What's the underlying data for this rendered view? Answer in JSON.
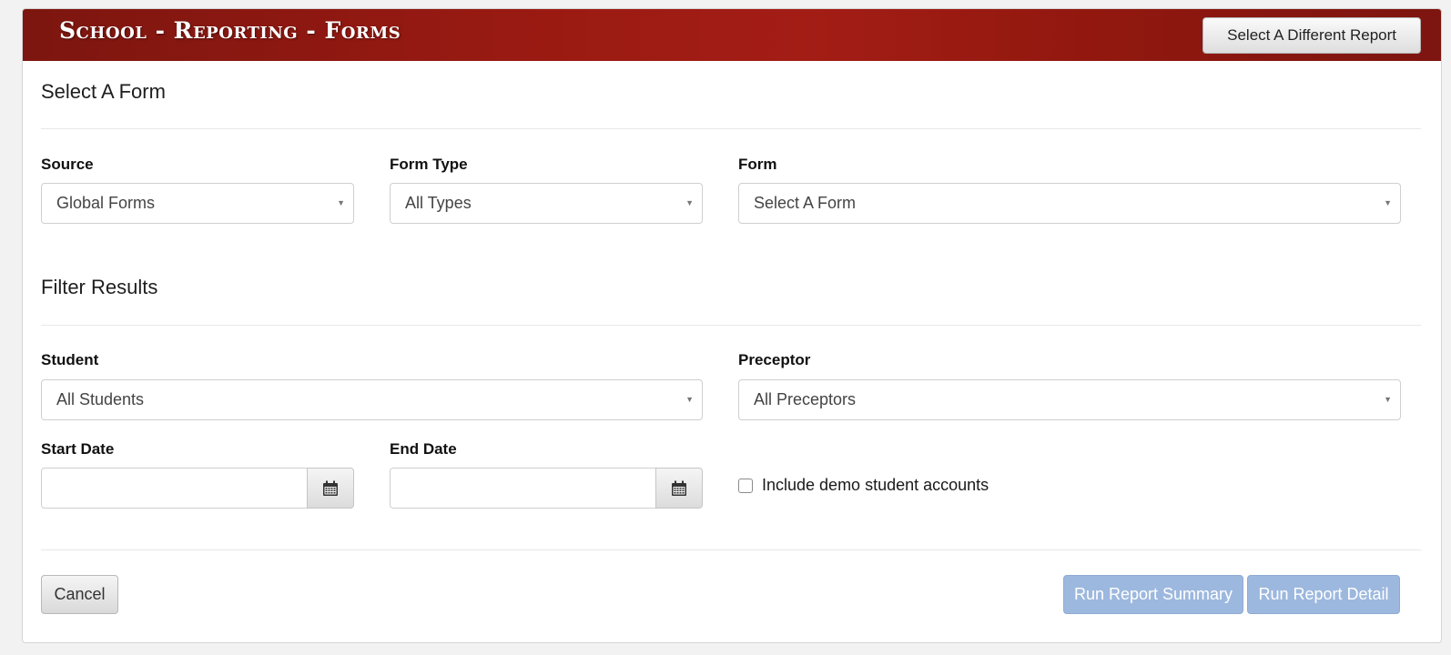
{
  "header": {
    "title": "School - Reporting - Forms",
    "select_report_label": "Select A Different Report"
  },
  "select_form": {
    "title": "Select A Form",
    "source_label": "Source",
    "source_value": "Global Forms",
    "form_type_label": "Form Type",
    "form_type_value": "All Types",
    "form_label": "Form",
    "form_value": "Select A Form"
  },
  "filter": {
    "title": "Filter Results",
    "student_label": "Student",
    "student_value": "All Students",
    "preceptor_label": "Preceptor",
    "preceptor_value": "All Preceptors",
    "start_date_label": "Start Date",
    "start_date_value": "",
    "end_date_label": "End Date",
    "end_date_value": "",
    "include_demo_label": "Include demo student accounts",
    "include_demo_checked": false
  },
  "actions": {
    "cancel_label": "Cancel",
    "run_summary_label": "Run Report Summary",
    "run_detail_label": "Run Report Detail"
  },
  "colors": {
    "header_red": "#a31d15",
    "run_button_blue": "#9db8de"
  },
  "icons": {
    "dropdown": "caret-down-icon",
    "date_picker": "calendar-icon"
  }
}
